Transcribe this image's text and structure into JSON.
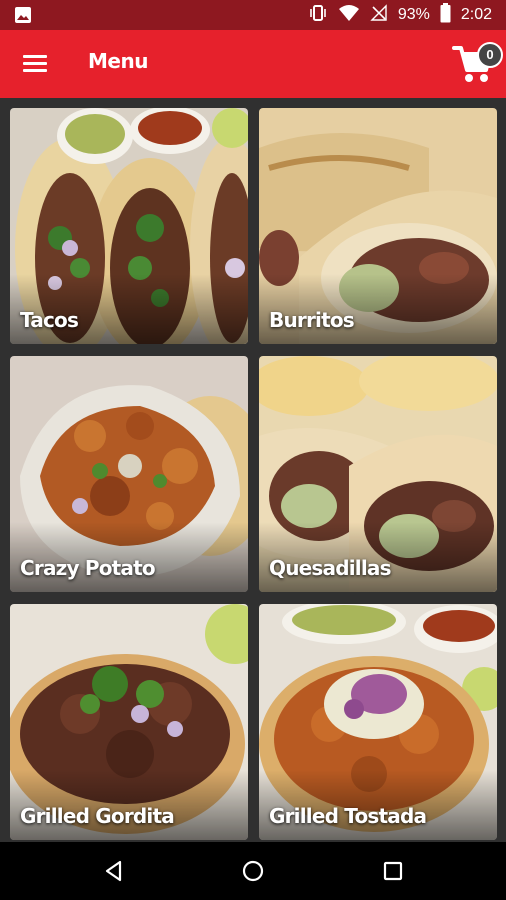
{
  "status_bar": {
    "battery_percent": "93%",
    "time": "2:02",
    "icons": [
      "image-icon",
      "vibrate-icon",
      "wifi-icon",
      "no-signal-icon",
      "battery-icon"
    ]
  },
  "app_bar": {
    "title": "Menu",
    "cart_count": "0",
    "icons": [
      "hamburger-menu-icon",
      "shopping-cart-icon"
    ],
    "color": "#e6212c"
  },
  "categories": [
    {
      "label": "Tacos"
    },
    {
      "label": "Burritos"
    },
    {
      "label": "Crazy Potato"
    },
    {
      "label": "Quesadillas"
    },
    {
      "label": "Grilled Gordita"
    },
    {
      "label": "Grilled Tostada"
    }
  ],
  "nav_bar": {
    "icons": [
      "back-icon",
      "home-icon",
      "recents-icon"
    ]
  }
}
